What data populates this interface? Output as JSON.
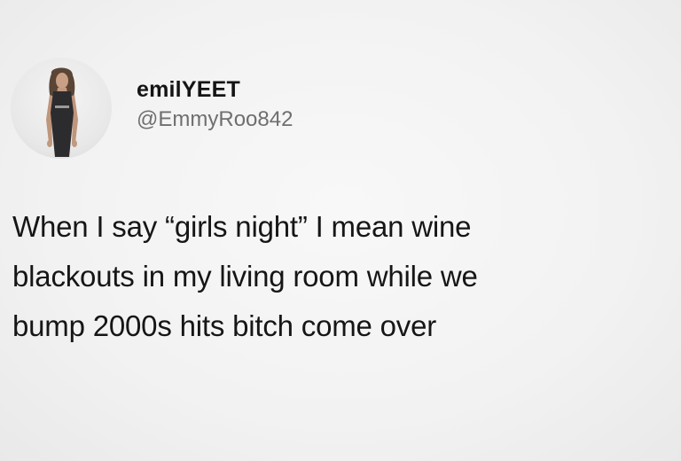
{
  "tweet": {
    "author": {
      "display_name": "emilYEET",
      "handle": "@EmmyRoo842",
      "avatar_icon": "profile-photo-avatar"
    },
    "text_lines": [
      "When I say “girls night” I mean wine",
      "blackouts in my living room while we",
      "bump 2000s hits bitch come over"
    ]
  },
  "colors": {
    "background": "#f3f3f3",
    "name_text": "#141414",
    "handle_text": "#6f6f6f",
    "body_text": "#161616"
  }
}
